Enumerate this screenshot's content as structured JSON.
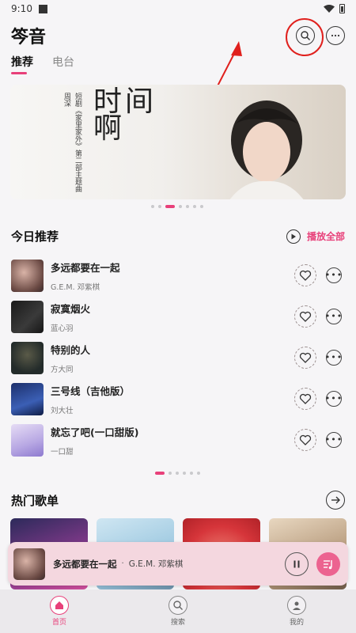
{
  "status_bar": {
    "time": "9:10"
  },
  "header": {
    "title": "笒音",
    "search_icon": "search-icon",
    "more_icon": "more-icon"
  },
  "tabs": [
    {
      "label": "推荐",
      "active": true
    },
    {
      "label": "电台",
      "active": false
    }
  ],
  "banner": {
    "col1": "周深",
    "col2": "短剧《家里家外》第二部主题曲",
    "big_text": "时间啊",
    "carousel_total": 7,
    "carousel_active": 2
  },
  "today": {
    "title": "今日推荐",
    "play_all": "播放全部",
    "songs": [
      {
        "title": "多远都要在一起",
        "artist": "G.E.M. 邓紫棋"
      },
      {
        "title": "寂寞烟火",
        "artist": "蓝心羽"
      },
      {
        "title": "特别的人",
        "artist": "方大同"
      },
      {
        "title": "三号线（吉他版）",
        "artist": "刘大壮"
      },
      {
        "title": "就忘了吧(一口甜版)",
        "artist": "一口甜"
      }
    ],
    "pager_total": 6,
    "pager_active": 0
  },
  "hot": {
    "title": "热门歌单"
  },
  "player": {
    "title": "多远都要在一起",
    "separator": "·",
    "artist": "G.E.M. 邓紫棋"
  },
  "nav": [
    {
      "label": "首页",
      "icon": "home-icon",
      "active": true
    },
    {
      "label": "搜索",
      "icon": "search-icon",
      "active": false
    },
    {
      "label": "我的",
      "icon": "user-icon",
      "active": false
    }
  ],
  "colors": {
    "accent": "#e8407a",
    "annotation": "#e0201d"
  }
}
